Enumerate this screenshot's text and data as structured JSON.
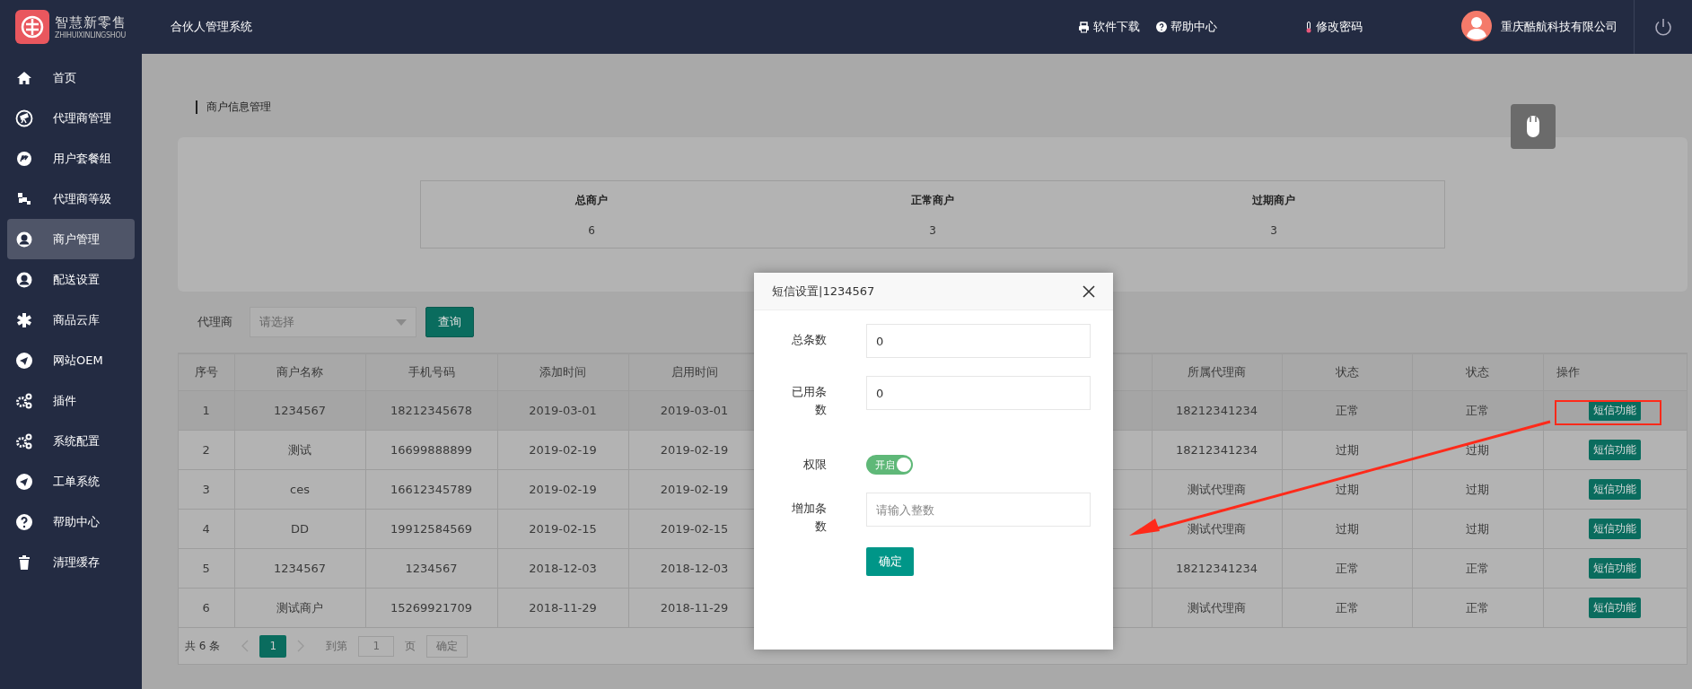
{
  "brand": {
    "name": "智慧新零售",
    "subtitle": "ZHIHUIXINLINGSHOU"
  },
  "system_title": "合伙人管理系统",
  "top_links": [
    {
      "label": "软件下载",
      "kind": "printer"
    },
    {
      "label": "帮助中心",
      "kind": "help"
    },
    {
      "label": "修改密码",
      "kind": "thermometer"
    }
  ],
  "user": {
    "name": "重庆酷航科技有限公司"
  },
  "sidebar": {
    "items": [
      {
        "label": "首页",
        "selected": false
      },
      {
        "label": "代理商管理",
        "selected": false
      },
      {
        "label": "用户套餐组",
        "selected": false
      },
      {
        "label": "代理商等级",
        "selected": false
      },
      {
        "label": "商户管理",
        "selected": true
      },
      {
        "label": "配送设置",
        "selected": false
      },
      {
        "label": "商品云库",
        "selected": false
      },
      {
        "label": "网站OEM",
        "selected": false
      },
      {
        "label": "插件",
        "selected": false
      },
      {
        "label": "系统配置",
        "selected": false
      },
      {
        "label": "工单系统",
        "selected": false
      },
      {
        "label": "帮助中心",
        "selected": false
      },
      {
        "label": "清理缓存",
        "selected": false
      }
    ]
  },
  "breadcrumb": "商户信息管理",
  "stats": [
    {
      "label": "总商户",
      "value": "6"
    },
    {
      "label": "正常商户",
      "value": "3"
    },
    {
      "label": "过期商户",
      "value": "3"
    }
  ],
  "filter": {
    "label": "代理商",
    "placeholder": "请选择",
    "button": "查询"
  },
  "table": {
    "columns": [
      "序号",
      "商户名称",
      "手机号码",
      "添加时间",
      "启用时间",
      "所属代理商",
      "状态",
      "状态",
      "操作"
    ],
    "rows": [
      {
        "cells": [
          "1",
          "1234567",
          "18212345678",
          "2019-03-01",
          "2019-03-01",
          "18212341234",
          "正常",
          "正常"
        ],
        "action": "短信功能",
        "hovered": true
      },
      {
        "cells": [
          "2",
          "测试",
          "16699888899",
          "2019-02-19",
          "2019-02-19",
          "18212341234",
          "过期",
          "过期"
        ],
        "action": "短信功能",
        "hovered": false
      },
      {
        "cells": [
          "3",
          "ces",
          "16612345789",
          "2019-02-19",
          "2019-02-19",
          "测试代理商",
          "过期",
          "过期"
        ],
        "action": "短信功能",
        "hovered": false
      },
      {
        "cells": [
          "4",
          "DD",
          "19912584569",
          "2019-02-15",
          "2019-02-15",
          "测试代理商",
          "过期",
          "过期"
        ],
        "action": "短信功能",
        "hovered": false
      },
      {
        "cells": [
          "5",
          "1234567",
          "1234567",
          "2018-12-03",
          "2018-12-03",
          "18212341234",
          "正常",
          "正常"
        ],
        "action": "短信功能",
        "hovered": false
      },
      {
        "cells": [
          "6",
          "测试商户",
          "15269921709",
          "2018-11-29",
          "2018-11-29",
          "测试代理商",
          "正常",
          "正常"
        ],
        "action": "短信功能",
        "hovered": false
      }
    ]
  },
  "pagination": {
    "total": "共 6 条",
    "pages": [
      {
        "label": "1",
        "selected": true
      }
    ],
    "goto_label": "到第",
    "goto_value": "1",
    "page_unit": "页",
    "confirm": "确定"
  },
  "dialog": {
    "title": "短信设置|1234567",
    "fields": [
      {
        "kind": "input",
        "label": "总条数",
        "value": "0"
      },
      {
        "kind": "input",
        "label": "已用条数",
        "value": "0"
      },
      {
        "kind": "switch",
        "label": "权限",
        "on": true,
        "on_text": "开启"
      },
      {
        "kind": "input",
        "label": "增加条数",
        "placeholder": "请输入整数"
      }
    ],
    "submit": "确定"
  }
}
